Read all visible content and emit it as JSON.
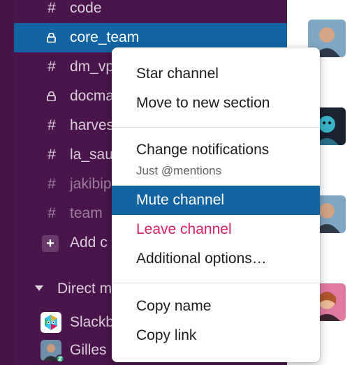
{
  "sidebar": {
    "channels": [
      {
        "glyph": "#",
        "name": "code",
        "type": "public"
      },
      {
        "glyph": "",
        "name": "core_team",
        "type": "private",
        "active": true
      },
      {
        "glyph": "#",
        "name": "dm_vp",
        "type": "public"
      },
      {
        "glyph": "",
        "name": "docma",
        "type": "private"
      },
      {
        "glyph": "#",
        "name": "harves",
        "type": "public"
      },
      {
        "glyph": "#",
        "name": "la_sau",
        "type": "public"
      },
      {
        "glyph": "#",
        "name": "jakibip",
        "type": "public",
        "muted": true
      },
      {
        "glyph": "#",
        "name": "team",
        "type": "public",
        "muted": true
      }
    ],
    "add_channels_label": "Add c",
    "direct_messages_label": "Direct m",
    "dms": [
      {
        "name": "Slackb",
        "icon": "slackbot-icon"
      },
      {
        "name": "Gilles",
        "icon": "user-avatar"
      }
    ]
  },
  "context_menu": {
    "star_channel": "Star channel",
    "move_to_section": "Move to new section",
    "change_notifications": "Change notifications",
    "notifications_value": "Just @mentions",
    "mute_channel": "Mute channel",
    "leave_channel": "Leave channel",
    "additional_options": "Additional options…",
    "copy_name": "Copy name",
    "copy_link": "Copy link"
  },
  "colors": {
    "sidebar_bg": "#4a154b",
    "active_bg": "#1264a3",
    "danger": "#e01e5a"
  }
}
